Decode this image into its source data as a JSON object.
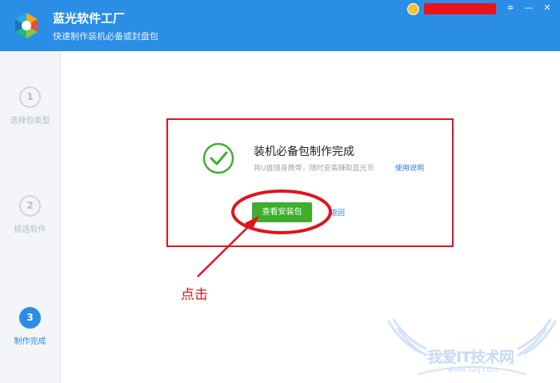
{
  "app": {
    "title": "蓝光软件工厂",
    "subtitle": "快速制作装机必备或封盘包"
  },
  "window_controls": {
    "menu_icon": "menu-icon",
    "minimize_icon": "minimize-icon",
    "close_icon": "close-icon",
    "menu_glyph": "≑",
    "minimize_glyph": "—",
    "close_glyph": "✕"
  },
  "colors": {
    "titlebar": "#2a8de6",
    "accent": "#2a8de6",
    "primary_button": "#3fae2f",
    "annotation_red": "#e0141c",
    "success_green": "#3fae2f"
  },
  "steps": [
    {
      "number": "1",
      "label": "选择包类型",
      "active": false
    },
    {
      "number": "2",
      "label": "挑选软件",
      "active": false
    },
    {
      "number": "3",
      "label": "制作完成",
      "active": true
    }
  ],
  "result": {
    "icon": "check-circle-icon",
    "title": "装机必备包制作完成",
    "hint": "将U盘随身携带，随时安装赚取蓝光币",
    "help_link": "使用说明",
    "primary_button": "查看安装包",
    "back_link": "返回"
  },
  "annotation": {
    "text": "点击"
  },
  "watermark": {
    "title": "我爱IT技术网",
    "url": "www.52ij.com"
  }
}
